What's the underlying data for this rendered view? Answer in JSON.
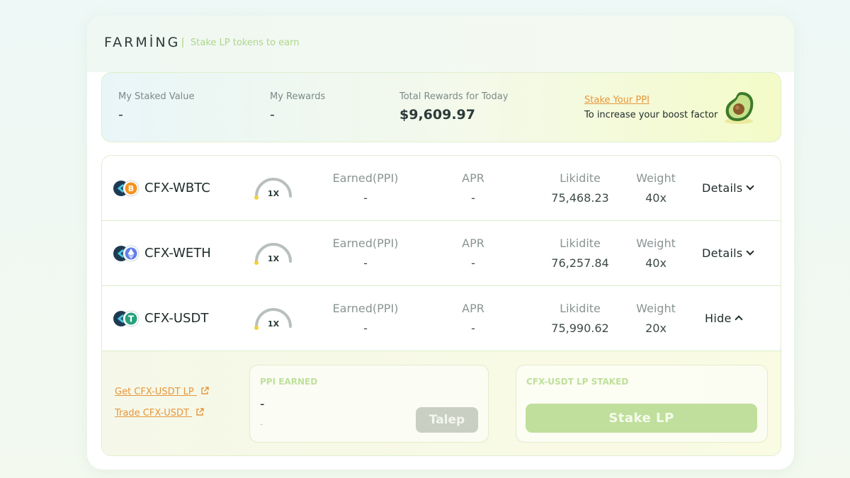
{
  "header": {
    "title": "FARMİNG",
    "subtitle": "Stake LP tokens to earn"
  },
  "summary": {
    "staked_label": "My Staked Value",
    "staked_value": "-",
    "rewards_label": "My Rewards",
    "rewards_value": "-",
    "total_label": "Total Rewards for Today",
    "total_value": "$9,609.97",
    "stake_link": "Stake Your PPI",
    "stake_sub": "To increase your boost factor"
  },
  "columns": {
    "earned": "Earned(PPI)",
    "apr": "APR",
    "liquidity": "Likidite",
    "weight": "Weight"
  },
  "pools": [
    {
      "pair": "CFX-WBTC",
      "boost": "1X",
      "earned": "-",
      "apr": "-",
      "liquidity": "75,468.23",
      "weight": "40x",
      "action": "Details",
      "token_icon": "bitcoin-icon",
      "token_color": "#f7931a"
    },
    {
      "pair": "CFX-WETH",
      "boost": "1X",
      "earned": "-",
      "apr": "-",
      "liquidity": "76,257.84",
      "weight": "40x",
      "action": "Details",
      "token_icon": "ethereum-icon",
      "token_color": "#627eea"
    },
    {
      "pair": "CFX-USDT",
      "boost": "1X",
      "earned": "-",
      "apr": "-",
      "liquidity": "75,990.62",
      "weight": "20x",
      "action": "Hide",
      "token_icon": "tether-icon",
      "token_color": "#26a17b"
    }
  ],
  "expanded": {
    "get_link": "Get CFX-USDT LP",
    "trade_link": "Trade CFX-USDT",
    "earned_label": "PPI EARNED",
    "earned_value": "-",
    "earned_sub": "-",
    "claim_button": "Talep",
    "staked_label": "CFX-USDT LP STAKED",
    "stake_button": "Stake LP"
  },
  "colors": {
    "accent_orange": "#e8963c",
    "accent_green": "#c0df9c",
    "gauge_dot": "#f2d13a"
  }
}
